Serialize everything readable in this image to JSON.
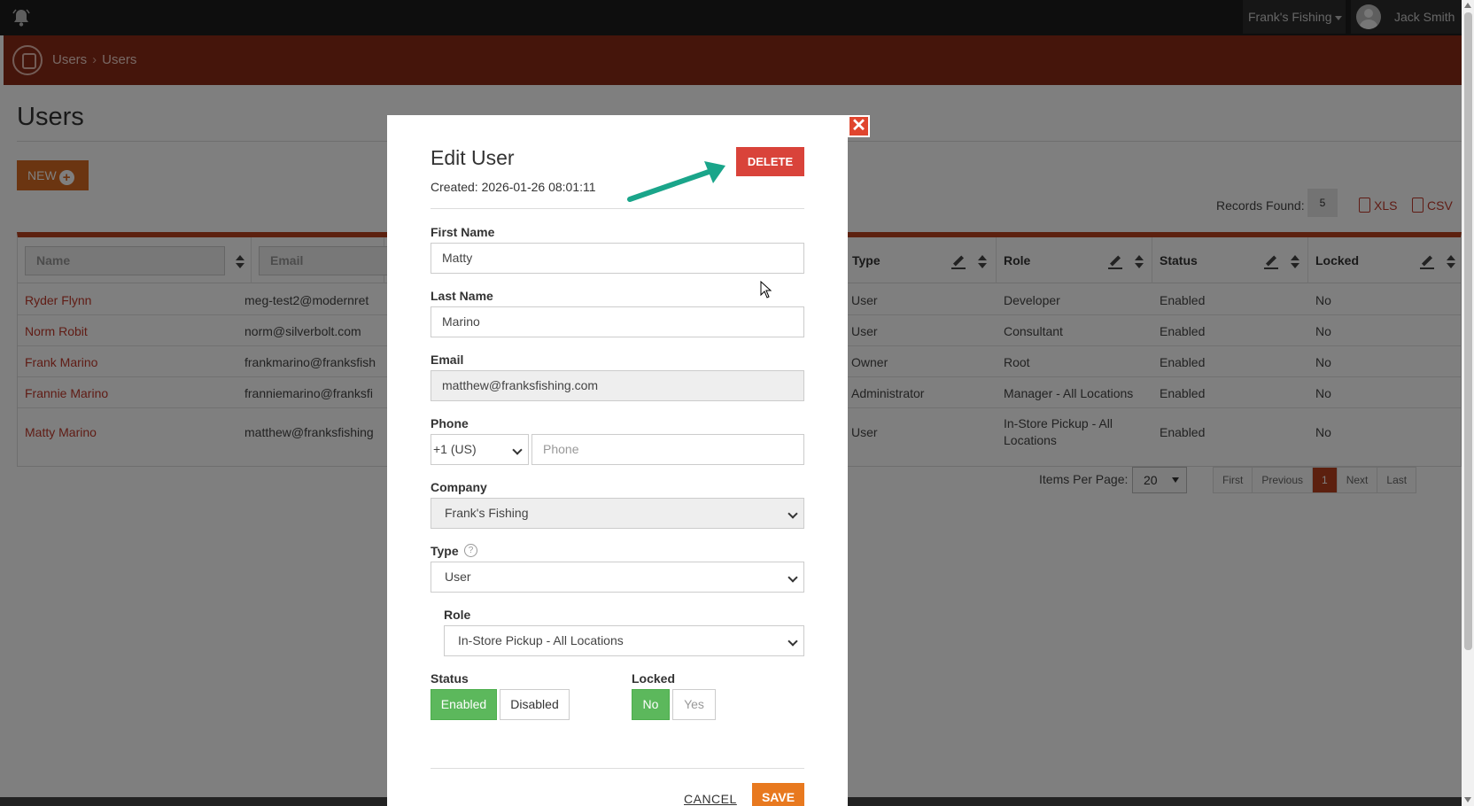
{
  "topbar": {
    "company": "Frank's Fishing",
    "user_name": "Jack Smith"
  },
  "breadcrumb": [
    "Users",
    "Users"
  ],
  "page": {
    "title": "Users",
    "new_label": "NEW",
    "records_label": "Records Found:",
    "records_count": "5",
    "export_xls": "XLS",
    "export_csv": "CSV"
  },
  "table": {
    "filters": {
      "name": "Name",
      "email": "Email"
    },
    "headers": {
      "type": "Type",
      "role": "Role",
      "status": "Status",
      "locked": "Locked"
    },
    "rows": [
      {
        "name": "Ryder Flynn",
        "email": "meg-test2@modernret",
        "type": "User",
        "role": "Developer",
        "role2": "",
        "status": "Enabled",
        "locked": "No"
      },
      {
        "name": "Norm Robit",
        "email": "norm@silverbolt.com",
        "type": "User",
        "role": "Consultant",
        "role2": "",
        "status": "Enabled",
        "locked": "No"
      },
      {
        "name": "Frank Marino",
        "email": "frankmarino@franksfish",
        "type": "Owner",
        "role": "Root",
        "role2": "",
        "status": "Enabled",
        "locked": "No"
      },
      {
        "name": "Frannie Marino",
        "email": "franniemarino@franksfi",
        "type": "Administrator",
        "role": "Manager - All Locations",
        "role2": "",
        "status": "Enabled",
        "locked": "No"
      },
      {
        "name": "Matty Marino",
        "email": "matthew@franksfishing",
        "type": "User",
        "role": "In-Store Pickup - All",
        "role2": "Locations",
        "status": "Enabled",
        "locked": "No"
      }
    ]
  },
  "pagination": {
    "items_per_page_label": "Items Per Page:",
    "items_per_page": "20",
    "pages": [
      "First",
      "Previous",
      "1",
      "Next",
      "Last"
    ]
  },
  "modal": {
    "title": "Edit User",
    "created": "Created: 2026-01-26 08:01:11",
    "delete_label": "DELETE",
    "close_glyph": "✕",
    "first_name_label": "First Name",
    "first_name": "Matty",
    "last_name_label": "Last Name",
    "last_name": "Marino",
    "email_label": "Email",
    "email": "matthew@franksfishing.com",
    "phone_label": "Phone",
    "phone_country": "+1 (US)",
    "phone_placeholder": "Phone",
    "company_label": "Company",
    "company": "Frank's Fishing",
    "type_label": "Type",
    "type": "User",
    "role_label": "Role",
    "role": "In-Store Pickup - All Locations",
    "status_label": "Status",
    "status_options": [
      "Enabled",
      "Disabled"
    ],
    "status_selected": "Enabled",
    "locked_label": "Locked",
    "locked_options": [
      "No",
      "Yes"
    ],
    "locked_selected": "No",
    "cancel_label": "CANCEL",
    "save_label": "SAVE"
  },
  "colors": {
    "brand_dark": "#8a2a16",
    "accent_orange": "#e8791f",
    "delete_red": "#d9433a",
    "toggle_green": "#5cb85c",
    "arrow_teal": "#1aa58a"
  }
}
